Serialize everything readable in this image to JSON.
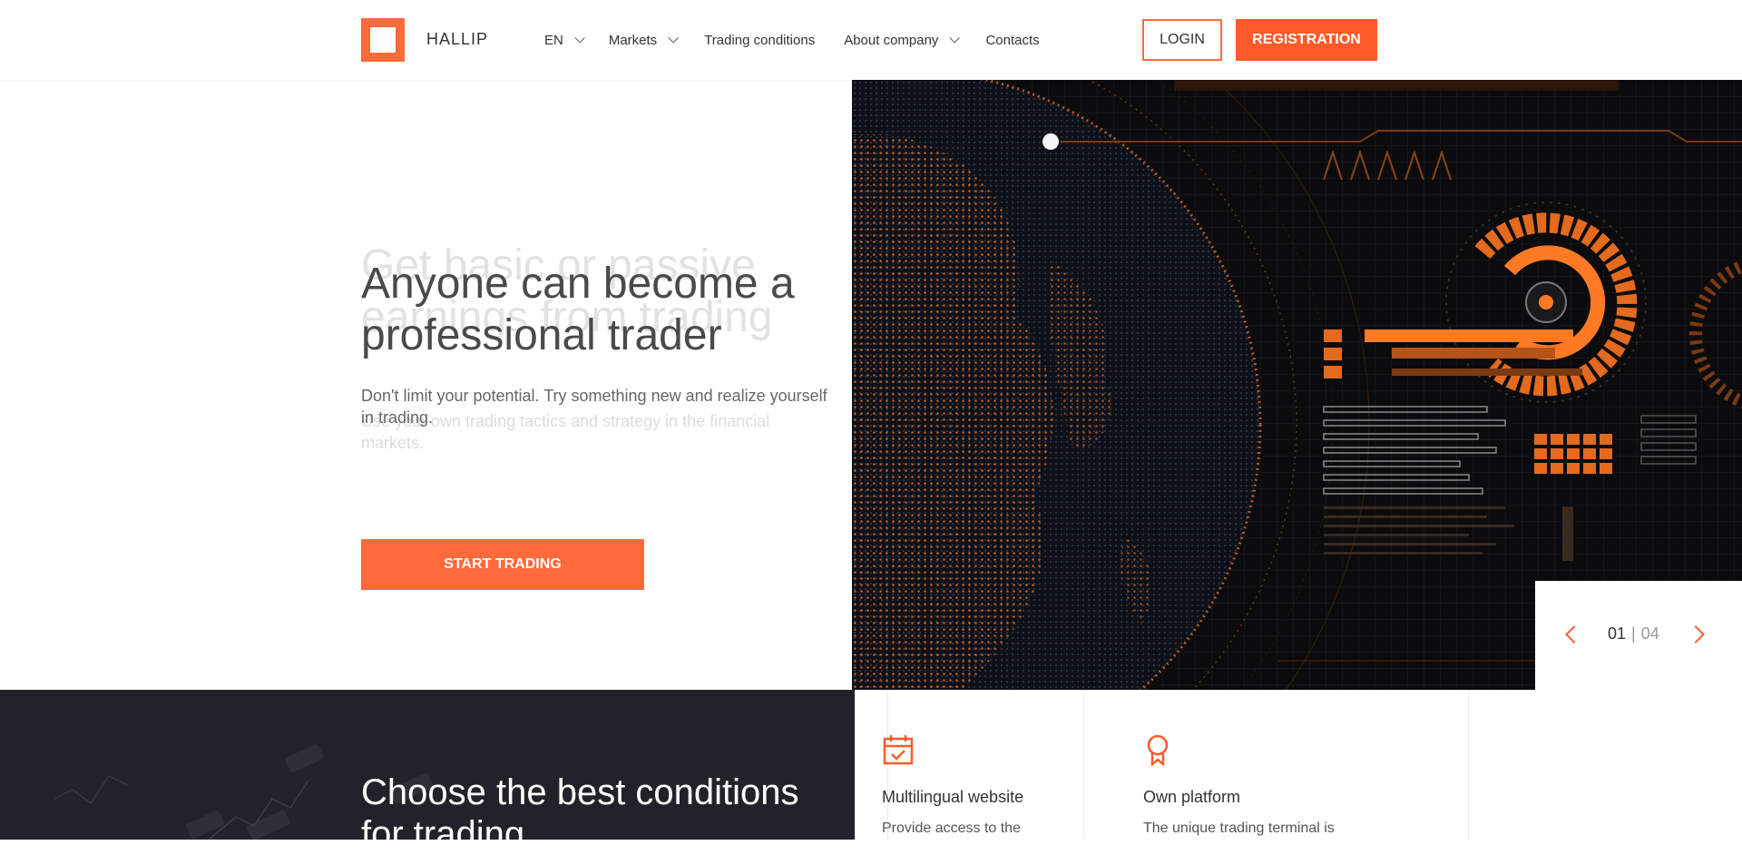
{
  "header": {
    "logo_text": "HALLIP",
    "nav": [
      {
        "label": "EN",
        "dropdown": true
      },
      {
        "label": "Markets",
        "dropdown": true
      },
      {
        "label": "Trading conditions",
        "dropdown": false
      },
      {
        "label": "About company",
        "dropdown": true
      },
      {
        "label": "Contacts",
        "dropdown": false
      }
    ],
    "login_label": "LOGIN",
    "registration_label": "REGISTRATION"
  },
  "hero": {
    "ghost_title": "Get basic or passive earnings from trading",
    "title": "Anyone can become a professional trader",
    "ghost_subtitle": "Use your own trading tactics and strategy in the financial markets.",
    "subtitle": "Don't limit your potential. Try something new and realize yourself in trading.",
    "cta_label": "START TRADING"
  },
  "slider": {
    "current": "01",
    "separator": "|",
    "total": "04"
  },
  "bottom": {
    "title": "Choose the best conditions for trading"
  },
  "features": [
    {
      "icon": "calendar-check-icon",
      "title": "Multilingual website",
      "text": "Provide access to the"
    },
    {
      "icon": "award-ribbon-icon",
      "title": "Own platform",
      "text": "The unique trading terminal is"
    }
  ],
  "colors": {
    "accent": "#ff6a3d",
    "accent_dark": "#ff5a2a",
    "dark_bg": "#22232a"
  }
}
